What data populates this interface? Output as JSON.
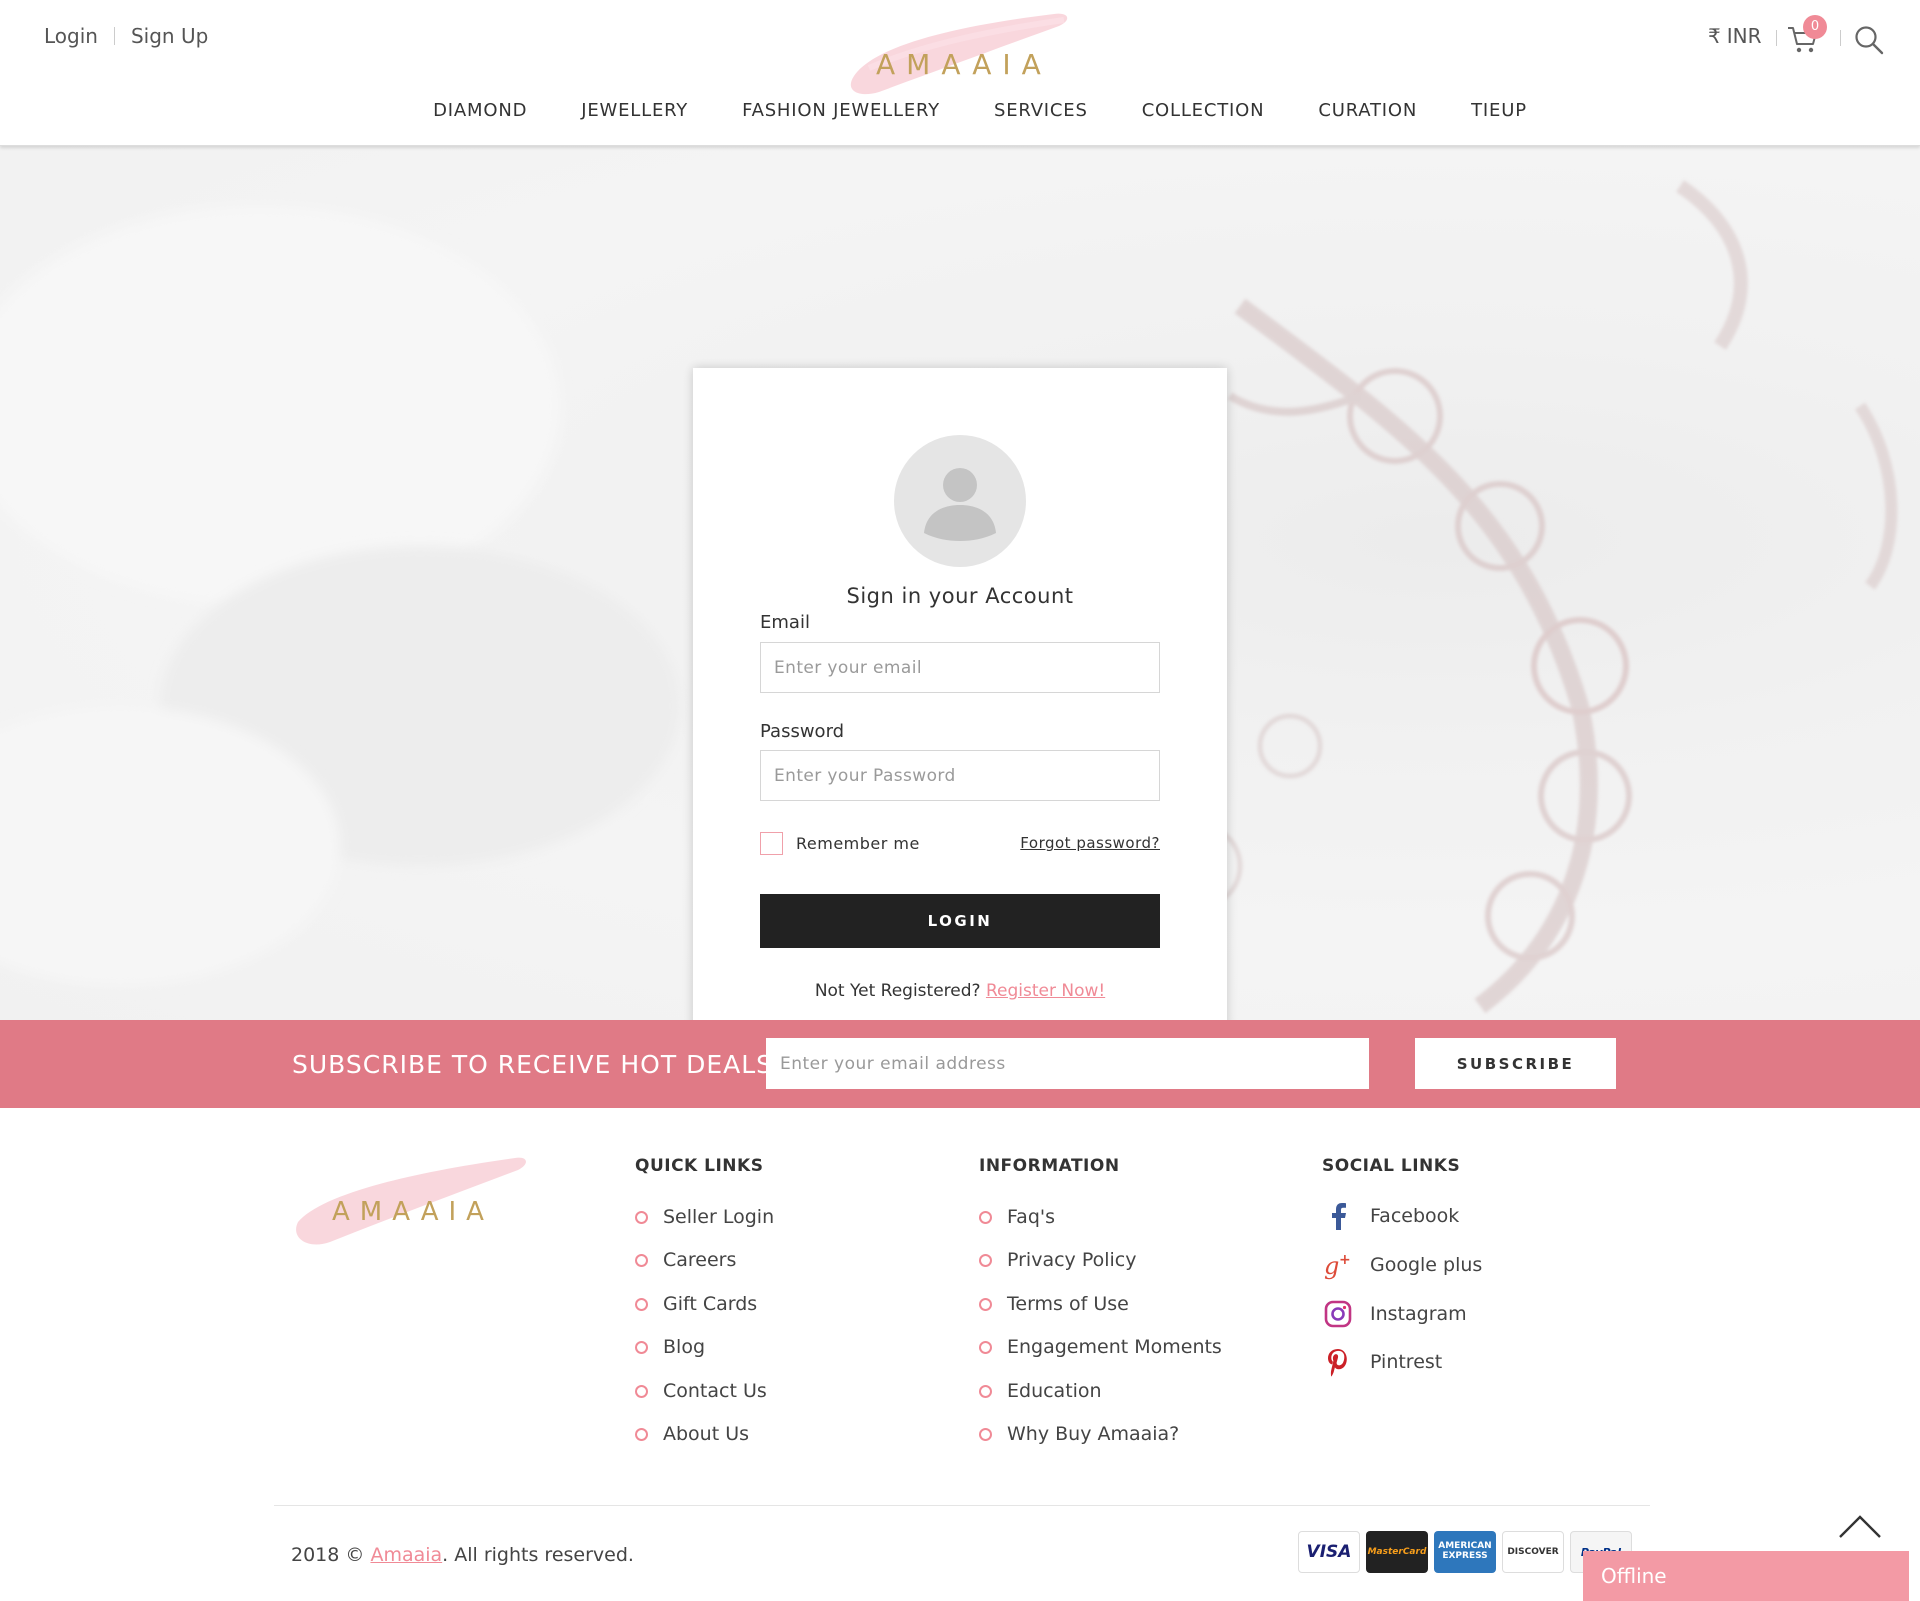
{
  "header": {
    "login_label": "Login",
    "signup_label": "Sign Up",
    "logo_text": "AMAAIA",
    "currency_symbol": "₹",
    "currency_code": "INR",
    "cart_count": "0",
    "nav": [
      "DIAMOND",
      "JEWELLERY",
      "FASHION JEWELLERY",
      "SERVICES",
      "COLLECTION",
      "CURATION",
      "TIEUP"
    ]
  },
  "login_form": {
    "title": "Sign in your Account",
    "email_label": "Email",
    "email_placeholder": "Enter your email",
    "password_label": "Password",
    "password_placeholder": "Enter your Password",
    "remember_label": "Remember me",
    "forgot_label": "Forgot password?",
    "login_button": "LOGIN",
    "register_prompt": "Not Yet Registered?",
    "register_link": "Register Now!"
  },
  "subscribe": {
    "title": "SUBSCRIBE TO RECEIVE HOT DEALS",
    "placeholder": "Enter your email address",
    "button": "SUBSCRIBE"
  },
  "footer": {
    "logo_text": "AMAAIA",
    "quick_links": {
      "heading": "QUICK LINKS",
      "items": [
        "Seller Login",
        "Careers",
        "Gift Cards",
        "Blog",
        "Contact Us",
        "About Us"
      ]
    },
    "information": {
      "heading": "INFORMATION",
      "items": [
        "Faq's",
        "Privacy Policy",
        "Terms of Use",
        "Engagement Moments",
        "Education",
        "Why Buy Amaaia?"
      ]
    },
    "social": {
      "heading": "SOCIAL LINKS",
      "items": [
        {
          "label": "Facebook",
          "icon": "facebook-icon"
        },
        {
          "label": "Google plus",
          "icon": "google-plus-icon"
        },
        {
          "label": "Instagram",
          "icon": "instagram-icon"
        },
        {
          "label": "Pintrest",
          "icon": "pinterest-icon"
        }
      ]
    },
    "copyright_prefix": "2018 ©",
    "copyright_brand": "Amaaia",
    "copyright_suffix": ". All rights reserved.",
    "payments": [
      "VISA",
      "MasterCard",
      "AMERICAN EXPRESS",
      "DISCOVER",
      "PayPal"
    ]
  },
  "chat": {
    "status": "Offline"
  },
  "colors": {
    "accent_pink": "#f08a96",
    "subscribe_band": "#e07a86",
    "logo_gold": "#c2a15b",
    "button_dark": "#222222"
  }
}
